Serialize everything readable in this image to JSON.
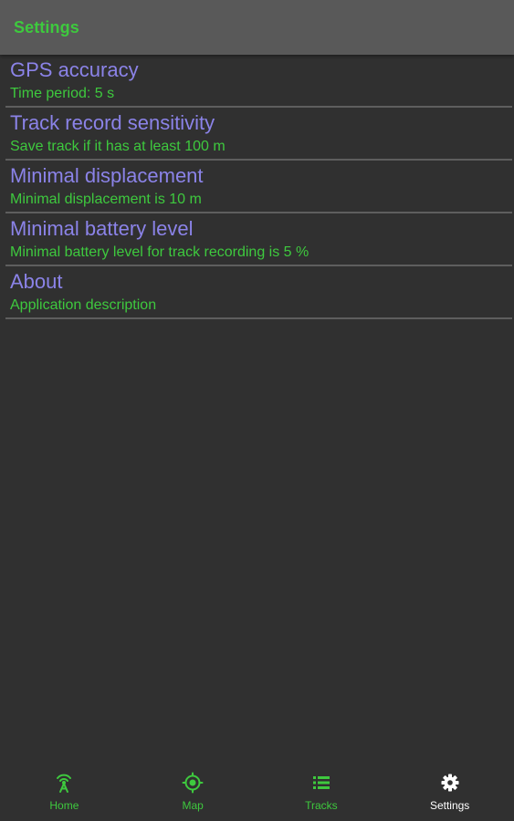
{
  "app_bar": {
    "title": "Settings"
  },
  "settings": [
    {
      "title": "GPS accuracy",
      "summary": "Time period: 5 s"
    },
    {
      "title": "Track record sensitivity",
      "summary": "Save track if it has at least 100 m"
    },
    {
      "title": "Minimal displacement",
      "summary": "Minimal displacement is 10 m"
    },
    {
      "title": "Minimal battery level",
      "summary": "Minimal battery level for track recording is 5 %"
    },
    {
      "title": "About",
      "summary": "Application description"
    }
  ],
  "bottom_nav": {
    "items": [
      {
        "label": "Home",
        "icon": "antenna-icon",
        "active": false
      },
      {
        "label": "Map",
        "icon": "location-target-icon",
        "active": false
      },
      {
        "label": "Tracks",
        "icon": "list-icon",
        "active": false
      },
      {
        "label": "Settings",
        "icon": "gear-icon",
        "active": true
      }
    ]
  },
  "colors": {
    "background": "#303030",
    "app_bar": "#595959",
    "accent_green": "#3ec93e",
    "title_purple": "#8b83e8",
    "divider": "#5e5e5e",
    "active_label": "#ffffff"
  }
}
